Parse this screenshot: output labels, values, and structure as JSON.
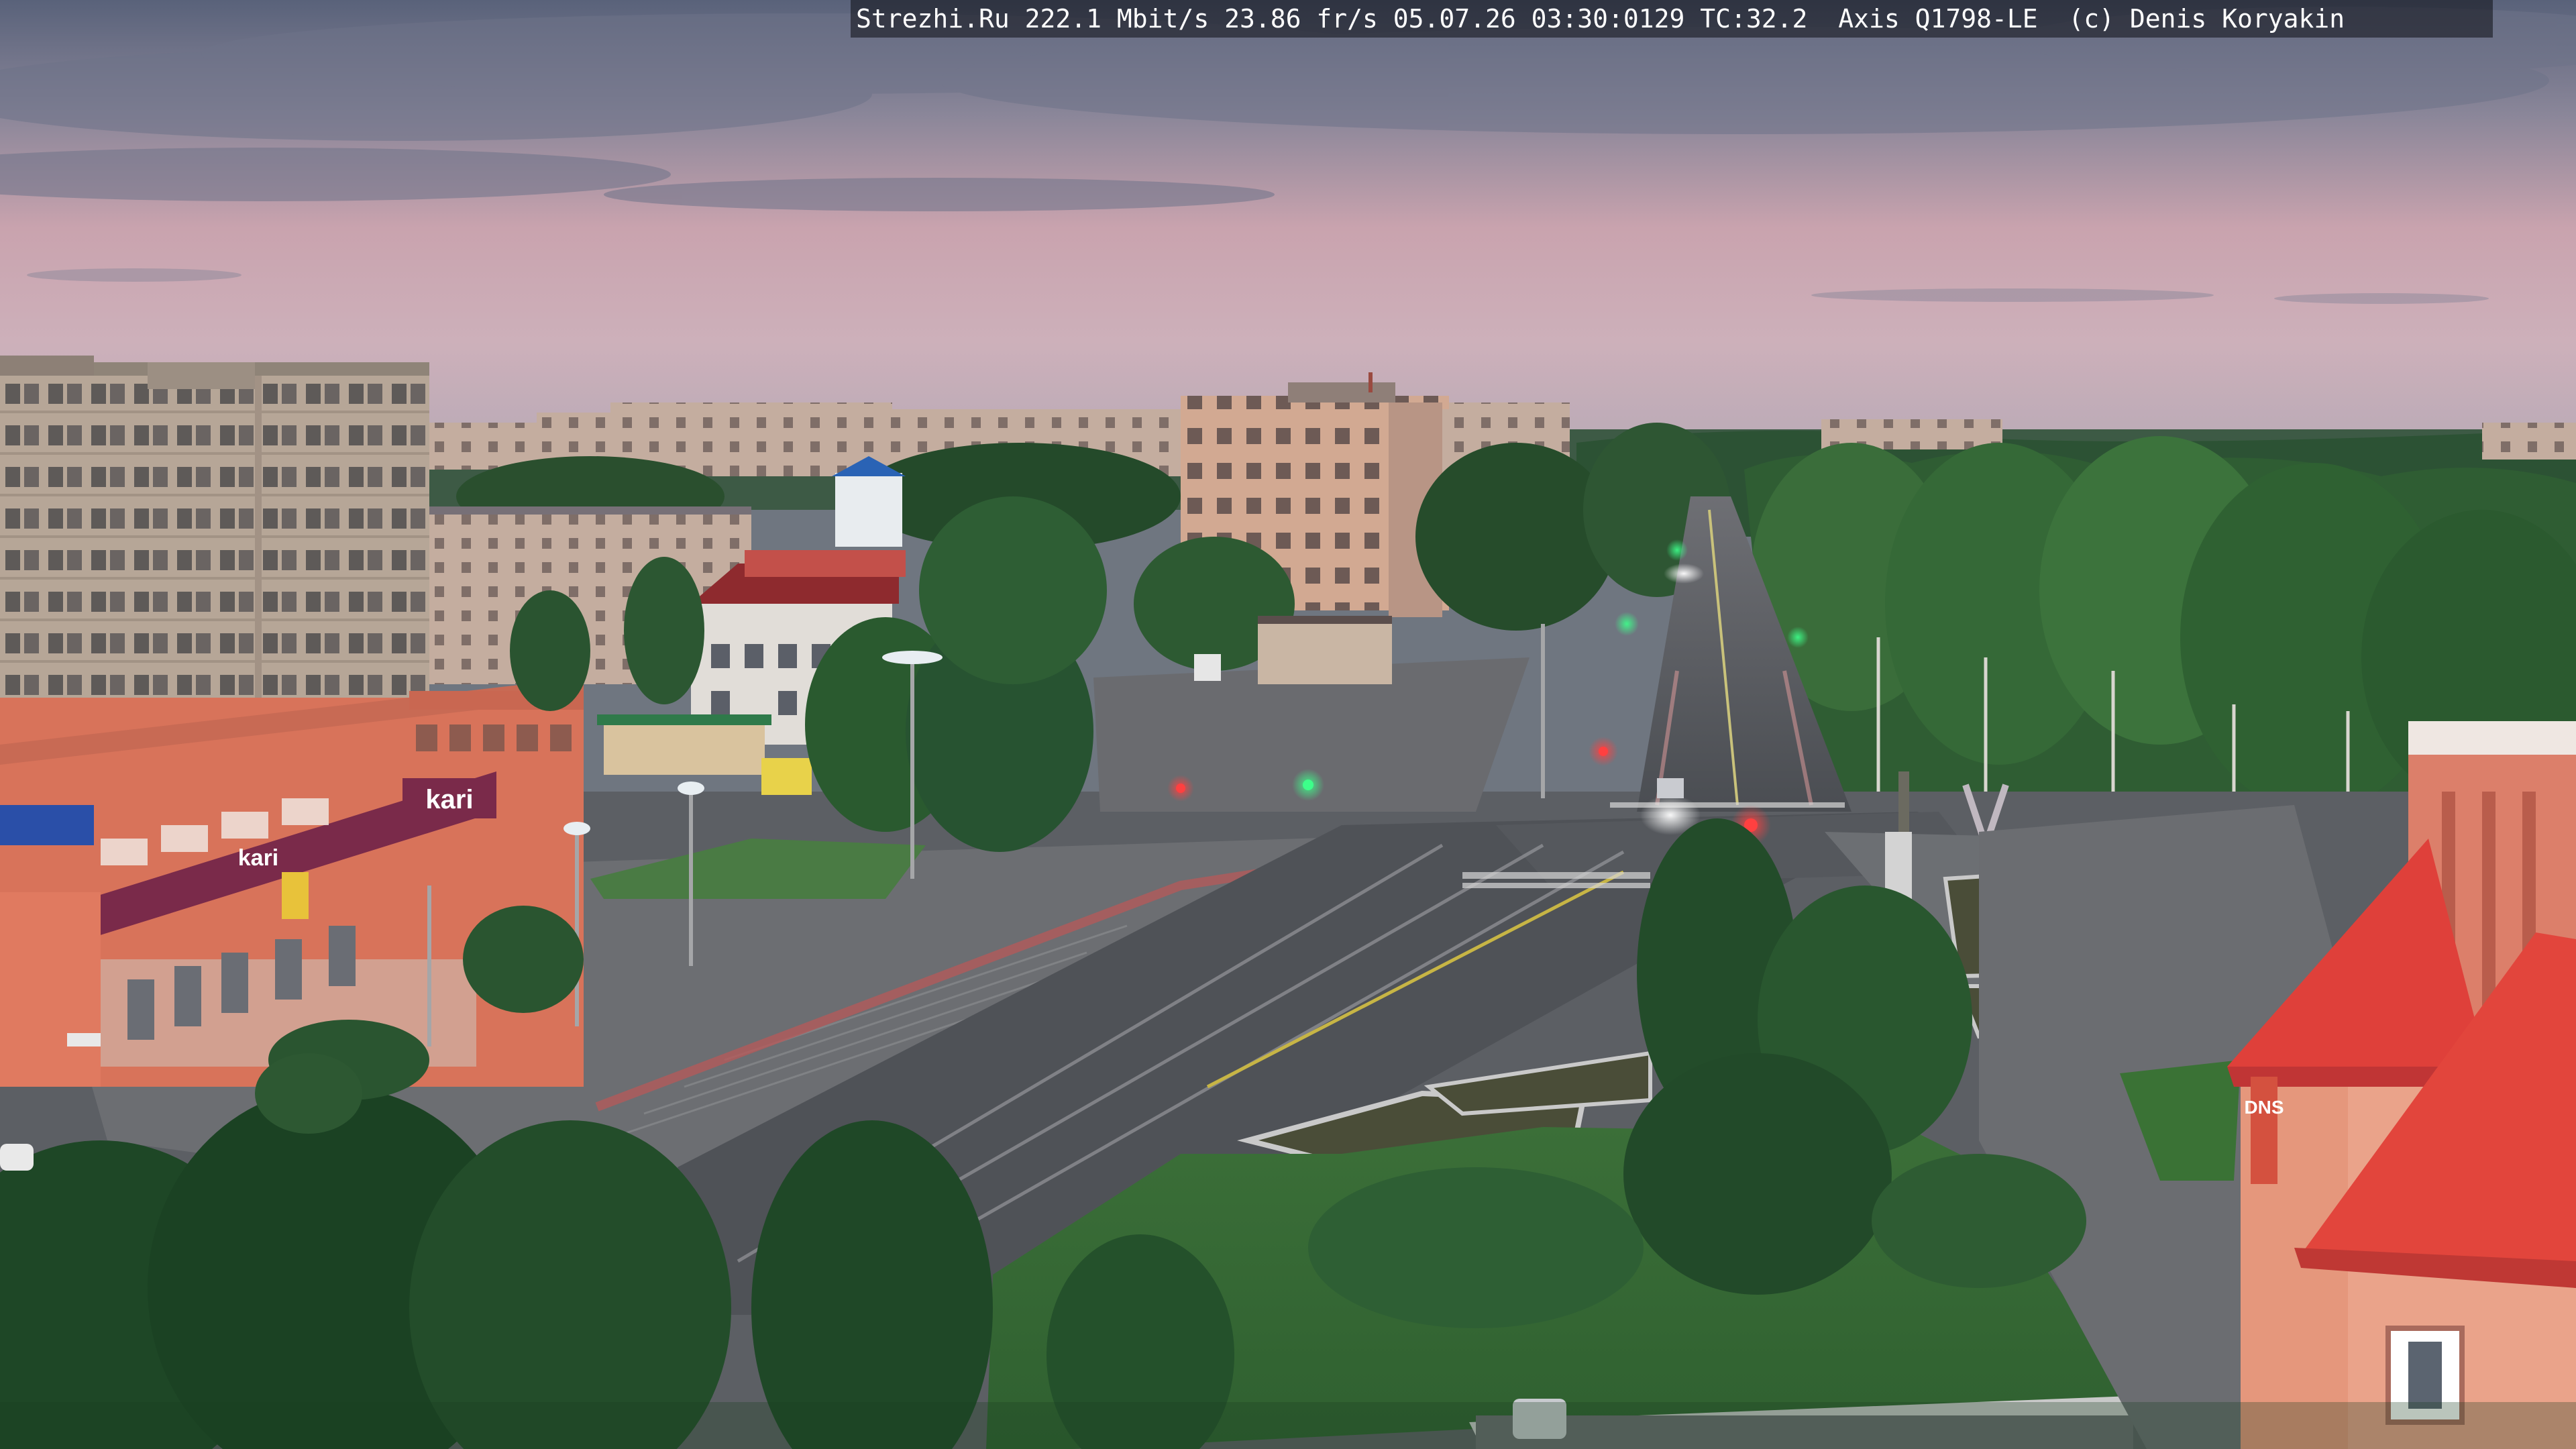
{
  "camera_overlay": {
    "text": "Strezhi.Ru 222.1 Mbit/s 23.86 fr/s 05.07.26 03:30:0129 TC:32.2  Axis Q1798-LE  (c) Denis Koryakin"
  },
  "signs": {
    "kari": "kari",
    "kari_small": "kari",
    "dns": "DNS"
  },
  "colors": {
    "sky_top": "#5d6579",
    "sky_pink": "#c9a3ae",
    "sky_horizon": "#c8aeb6",
    "panel_building": "#b9a99a",
    "brick_store": "#d9775e",
    "store_sign": "#7a2a4a",
    "red_roof": "#e0403a",
    "tree_dark": "#1f4a28",
    "tree_mid": "#2f5f33",
    "asphalt": "#55585e",
    "grass": "#3f7a3a"
  }
}
